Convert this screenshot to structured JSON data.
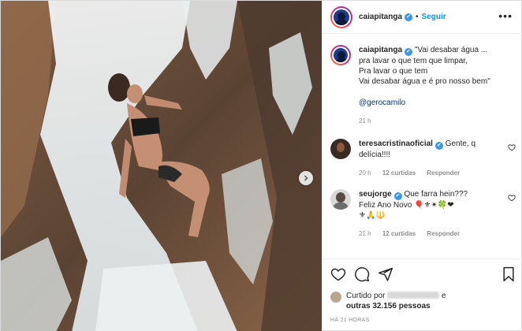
{
  "post": {
    "author": "caiapitanga",
    "follow_label": "Seguir",
    "separator": "•",
    "more_label": "•••",
    "verified_mark": "✔"
  },
  "caption": {
    "username": "caiapitanga",
    "text": "\"Vai desabar água ...\npra lavar o que tem que limpar,\nPra lavar o que tem\nVai desabar água e é pro nosso bem\"",
    "mention": "@gerocamilo",
    "time": "21 h"
  },
  "comments": [
    {
      "username": "teresacristinaoficial",
      "text": "Gente, q delícia!!!!",
      "time": "20 h",
      "likes": "12 curtidas",
      "reply": "Responder"
    },
    {
      "username": "seujorge",
      "text": "Que farra hein???\nFeliz Ano Novo 🎈⚜✴🍀❤\n⚜🙏🔱",
      "time": "21 h",
      "likes": "12 curtidas",
      "reply": "Responder"
    }
  ],
  "likes": {
    "prefix": "Curtido por",
    "conj": "e",
    "others": "outras 32.156 pessoas"
  },
  "timestamp": "HÁ 21 HORAS",
  "icons": {
    "like": "heart-icon",
    "comment": "comment-icon",
    "share": "share-icon",
    "save": "bookmark-icon",
    "next": "chevron-right-icon"
  },
  "colors": {
    "accent": "#0095f6",
    "verified": "#3897f0",
    "muted": "#8e8e8e",
    "mention": "#00376b"
  }
}
